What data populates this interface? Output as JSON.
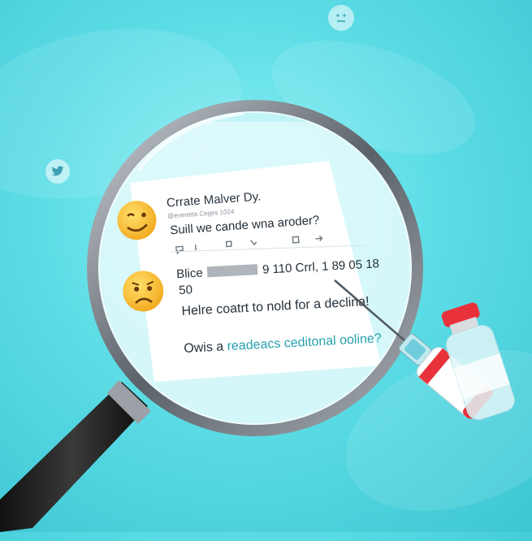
{
  "post1": {
    "name": "Crrate Malver Dy.",
    "handle": "@everetta Ceges 1024",
    "text": "Suill we cande wna aroder?"
  },
  "post2": {
    "name_prefix": "Blice",
    "numbers": "9 110 Crrl, 1 89 05 18",
    "line2": "50",
    "text": "Helre coatrt to nold for a declina!"
  },
  "question": {
    "prefix": "Owis a ",
    "highlight": "readeacs ceditonal ooline?"
  },
  "colors": {
    "background": "#5ddde6",
    "link": "#27a0ae",
    "lens_ring": "#6a7178",
    "syringe_red": "#e8313a",
    "emoji_yellow": "#f6c03a"
  },
  "icons": [
    "twitter-icon",
    "neutral-face-icon",
    "wink-emoji-icon",
    "worried-emoji-icon",
    "comment-icon",
    "retweet-icon",
    "like-icon",
    "share-icon",
    "send-icon",
    "magnifying-glass-icon",
    "syringe-icon",
    "vaccine-vial-icon"
  ]
}
